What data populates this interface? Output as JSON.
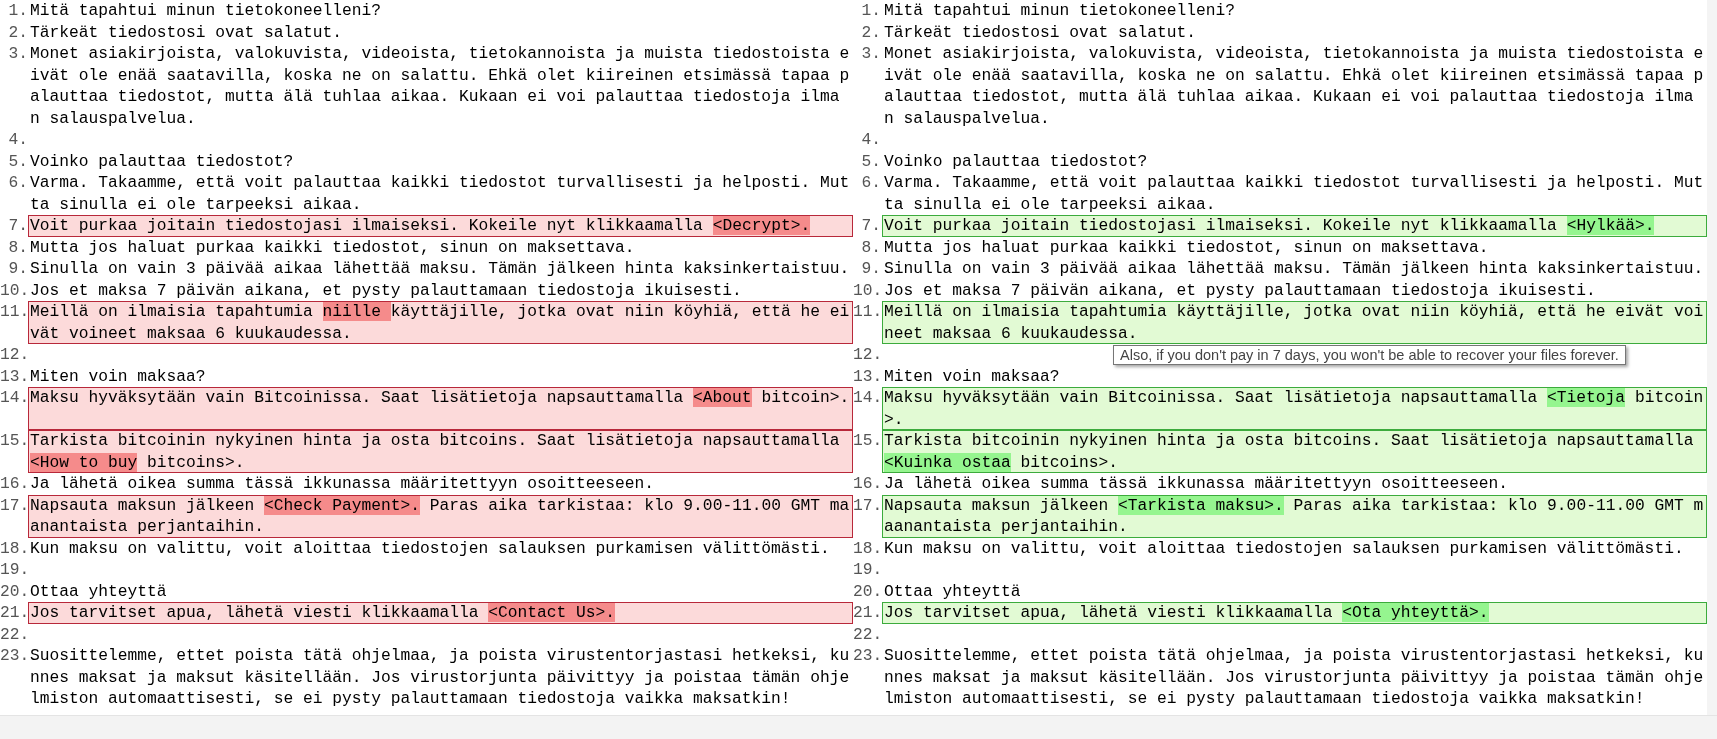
{
  "left_pane": {
    "lines": [
      {
        "number": "1.",
        "changed": false,
        "segments": [
          {
            "text": "Mitä tapahtui minun tietokoneelleni?",
            "highlighted": false
          }
        ]
      },
      {
        "number": "2.",
        "changed": false,
        "segments": [
          {
            "text": "Tärkeät tiedostosi ovat salatut.",
            "highlighted": false
          }
        ]
      },
      {
        "number": "3.",
        "changed": false,
        "segments": [
          {
            "text": "Monet asiakirjoista, valokuvista, videoista, tietokannoista ja muista tiedostoista eivät ole enää saatavilla, koska ne on salattu. Ehkä olet kiireinen etsimässä tapaa palauttaa tiedostot, mutta älä tuhlaa aikaa. Kukaan ei voi palauttaa tiedostoja ilman salauspalvelua.",
            "highlighted": false
          }
        ]
      },
      {
        "number": "4.",
        "changed": false
      },
      {
        "number": "5.",
        "changed": false,
        "segments": [
          {
            "text": "Voinko palauttaa tiedostot?",
            "highlighted": false
          }
        ]
      },
      {
        "number": "6.",
        "changed": false,
        "segments": [
          {
            "text": "Varma. Takaamme, että voit palauttaa kaikki tiedostot turvallisesti ja helposti. Mutta sinulla ei ole tarpeeksi aikaa.",
            "highlighted": false
          }
        ]
      },
      {
        "number": "7.",
        "changed": true,
        "segments": [
          {
            "text": "Voit purkaa joitain tiedostojasi ilmaiseksi. Kokeile nyt klikkaamalla ",
            "highlighted": false
          },
          {
            "text": "<Decrypt>.",
            "highlighted": true
          }
        ]
      },
      {
        "number": "8.",
        "changed": false,
        "segments": [
          {
            "text": "Mutta jos haluat purkaa kaikki tiedostot, sinun on maksettava.",
            "highlighted": false
          }
        ]
      },
      {
        "number": "9.",
        "changed": false,
        "segments": [
          {
            "text": "Sinulla on vain 3 päivää aikaa lähettää maksu. Tämän jälkeen hinta kaksinkertaistuu.",
            "highlighted": false
          }
        ]
      },
      {
        "number": "10.",
        "changed": false,
        "segments": [
          {
            "text": "Jos et maksa 7 päivän aikana, et pysty palauttamaan tiedostoja ikuisesti.",
            "highlighted": false
          }
        ]
      },
      {
        "number": "11.",
        "changed": true,
        "segments": [
          {
            "text": "Meillä on ilmaisia tapahtumia ",
            "highlighted": false
          },
          {
            "text": "niille ",
            "highlighted": true
          },
          {
            "text": "käyttäjille, jotka ovat niin köyhiä, että he eivät voineet maksaa 6 kuukaudessa.",
            "highlighted": false
          }
        ]
      },
      {
        "number": "12.",
        "changed": false
      },
      {
        "number": "13.",
        "changed": false,
        "segments": [
          {
            "text": "Miten voin maksaa?",
            "highlighted": false
          }
        ]
      },
      {
        "number": "14.",
        "changed": true,
        "segments": [
          {
            "text": "Maksu hyväksytään vain Bitcoinissa. Saat lisätietoja napsauttamalla ",
            "highlighted": false
          },
          {
            "text": "<About",
            "highlighted": true
          },
          {
            "text": " bitcoin>.",
            "highlighted": false
          }
        ]
      },
      {
        "number": "15.",
        "changed": true,
        "segments": [
          {
            "text": "Tarkista bitcoinin nykyinen hinta ja osta bitcoins. Saat lisätietoja napsauttamalla ",
            "highlighted": false
          },
          {
            "text": "<How to buy",
            "highlighted": true
          },
          {
            "text": " bitcoins>.",
            "highlighted": false
          }
        ]
      },
      {
        "number": "16.",
        "changed": false,
        "segments": [
          {
            "text": "Ja lähetä oikea summa tässä ikkunassa määritettyyn osoitteeseen.",
            "highlighted": false
          }
        ]
      },
      {
        "number": "17.",
        "changed": true,
        "segments": [
          {
            "text": "Napsauta maksun jälkeen ",
            "highlighted": false
          },
          {
            "text": "<Check Payment>.",
            "highlighted": true
          },
          {
            "text": " Paras aika tarkistaa: klo 9.00-11.00 GMT maanantaista perjantaihin.",
            "highlighted": false
          }
        ]
      },
      {
        "number": "18.",
        "changed": false,
        "segments": [
          {
            "text": "Kun maksu on valittu, voit aloittaa tiedostojen salauksen purkamisen välittömästi.",
            "highlighted": false
          }
        ]
      },
      {
        "number": "19.",
        "changed": false
      },
      {
        "number": "20.",
        "changed": false,
        "segments": [
          {
            "text": "Ottaa yhteyttä",
            "highlighted": false
          }
        ]
      },
      {
        "number": "21.",
        "changed": true,
        "segments": [
          {
            "text": "Jos tarvitset apua, lähetä viesti klikkaamalla ",
            "highlighted": false
          },
          {
            "text": "<Contact Us>.",
            "highlighted": true
          }
        ]
      },
      {
        "number": "22.",
        "changed": false
      },
      {
        "number": "23.",
        "changed": false,
        "segments": [
          {
            "text": "Suosittelemme, ettet poista tätä ohjelmaa, ja poista virustentorjastasi hetkeksi, kunnes maksat ja maksut käsitellään. Jos virustorjunta päivittyy ja poistaa tämän ohjelmiston automaattisesti, se ei pysty palauttamaan tiedostoja vaikka maksatkin!",
            "highlighted": false
          }
        ]
      }
    ]
  },
  "right_pane": {
    "lines": [
      {
        "number": "1.",
        "changed": false,
        "segments": [
          {
            "text": "Mitä tapahtui minun tietokoneelleni?",
            "highlighted": false
          }
        ]
      },
      {
        "number": "2.",
        "changed": false,
        "segments": [
          {
            "text": "Tärkeät tiedostosi ovat salatut.",
            "highlighted": false
          }
        ]
      },
      {
        "number": "3.",
        "changed": false,
        "segments": [
          {
            "text": "Monet asiakirjoista, valokuvista, videoista, tietokannoista ja muista tiedostoista eivät ole enää saatavilla, koska ne on salattu. Ehkä olet kiireinen etsimässä tapaa palauttaa tiedostot, mutta älä tuhlaa aikaa. Kukaan ei voi palauttaa tiedostoja ilman salauspalvelua.",
            "highlighted": false
          }
        ]
      },
      {
        "number": "4.",
        "changed": false
      },
      {
        "number": "5.",
        "changed": false,
        "segments": [
          {
            "text": "Voinko palauttaa tiedostot?",
            "highlighted": false
          }
        ]
      },
      {
        "number": "6.",
        "changed": false,
        "segments": [
          {
            "text": "Varma. Takaamme, että voit palauttaa kaikki tiedostot turvallisesti ja helposti. Mutta sinulla ei ole tarpeeksi aikaa.",
            "highlighted": false
          }
        ]
      },
      {
        "number": "7.",
        "changed": true,
        "segments": [
          {
            "text": "Voit purkaa joitain tiedostojasi ilmaiseksi. Kokeile nyt klikkaamalla ",
            "highlighted": false
          },
          {
            "text": "<Hylkää>.",
            "highlighted": true
          }
        ]
      },
      {
        "number": "8.",
        "changed": false,
        "segments": [
          {
            "text": "Mutta jos haluat purkaa kaikki tiedostot, sinun on maksettava.",
            "highlighted": false
          }
        ]
      },
      {
        "number": "9.",
        "changed": false,
        "segments": [
          {
            "text": "Sinulla on vain 3 päivää aikaa lähettää maksu. Tämän jälkeen hinta kaksinkertaistuu.",
            "highlighted": false
          }
        ]
      },
      {
        "number": "10.",
        "changed": false,
        "segments": [
          {
            "text": "Jos et maksa 7 päivän aikana, et pysty palauttamaan tiedostoja ikuisesti.",
            "highlighted": false
          }
        ]
      },
      {
        "number": "11.",
        "changed": true,
        "segments": [
          {
            "text": "Meillä on ilmaisia tapahtumia käyttäjille, jotka ovat niin köyhiä, että he eivät voineet maksaa 6 kuukaudessa.",
            "highlighted": false
          }
        ]
      },
      {
        "number": "12.",
        "changed": false
      },
      {
        "number": "13.",
        "changed": false,
        "segments": [
          {
            "text": "Miten voin maksaa?",
            "highlighted": false
          }
        ]
      },
      {
        "number": "14.",
        "changed": true,
        "segments": [
          {
            "text": "Maksu hyväksytään vain Bitcoinissa. Saat lisätietoja napsauttamalla ",
            "highlighted": false
          },
          {
            "text": "<Tietoja",
            "highlighted": true
          },
          {
            "text": " bitcoin>.",
            "highlighted": false
          }
        ]
      },
      {
        "number": "15.",
        "changed": true,
        "segments": [
          {
            "text": "Tarkista bitcoinin nykyinen hinta ja osta bitcoins. Saat lisätietoja napsauttamalla ",
            "highlighted": false
          },
          {
            "text": "<Kuinka ostaa",
            "highlighted": true
          },
          {
            "text": " bitcoins>.",
            "highlighted": false
          }
        ]
      },
      {
        "number": "16.",
        "changed": false,
        "segments": [
          {
            "text": "Ja lähetä oikea summa tässä ikkunassa määritettyyn osoitteeseen.",
            "highlighted": false
          }
        ]
      },
      {
        "number": "17.",
        "changed": true,
        "segments": [
          {
            "text": "Napsauta maksun jälkeen ",
            "highlighted": false
          },
          {
            "text": "<Tarkista maksu>.",
            "highlighted": true
          },
          {
            "text": " Paras aika tarkistaa: klo 9.00-11.00 GMT maanantaista perjantaihin.",
            "highlighted": false
          }
        ]
      },
      {
        "number": "18.",
        "changed": false,
        "segments": [
          {
            "text": "Kun maksu on valittu, voit aloittaa tiedostojen salauksen purkamisen välittömästi.",
            "highlighted": false
          }
        ]
      },
      {
        "number": "19.",
        "changed": false
      },
      {
        "number": "20.",
        "changed": false,
        "segments": [
          {
            "text": "Ottaa yhteyttä",
            "highlighted": false
          }
        ]
      },
      {
        "number": "21.",
        "changed": true,
        "segments": [
          {
            "text": "Jos tarvitset apua, lähetä viesti klikkaamalla ",
            "highlighted": false
          },
          {
            "text": "<Ota yhteyttä>.",
            "highlighted": true
          }
        ]
      },
      {
        "number": "22.",
        "changed": false
      },
      {
        "number": "23.",
        "changed": false,
        "segments": [
          {
            "text": "Suosittelemme, ettet poista tätä ohjelmaa, ja poista virustentorjastasi hetkeksi, kunnes maksat ja maksut käsitellään. Jos virustorjunta päivittyy ja poistaa tämän ohjelmiston automaattisesti, se ei pysty palauttamaan tiedostoja vaikka maksatkin!",
            "highlighted": false
          }
        ]
      }
    ]
  },
  "tooltip": "Also, if you don't pay in 7 days, you won't be able to recover your files forever."
}
